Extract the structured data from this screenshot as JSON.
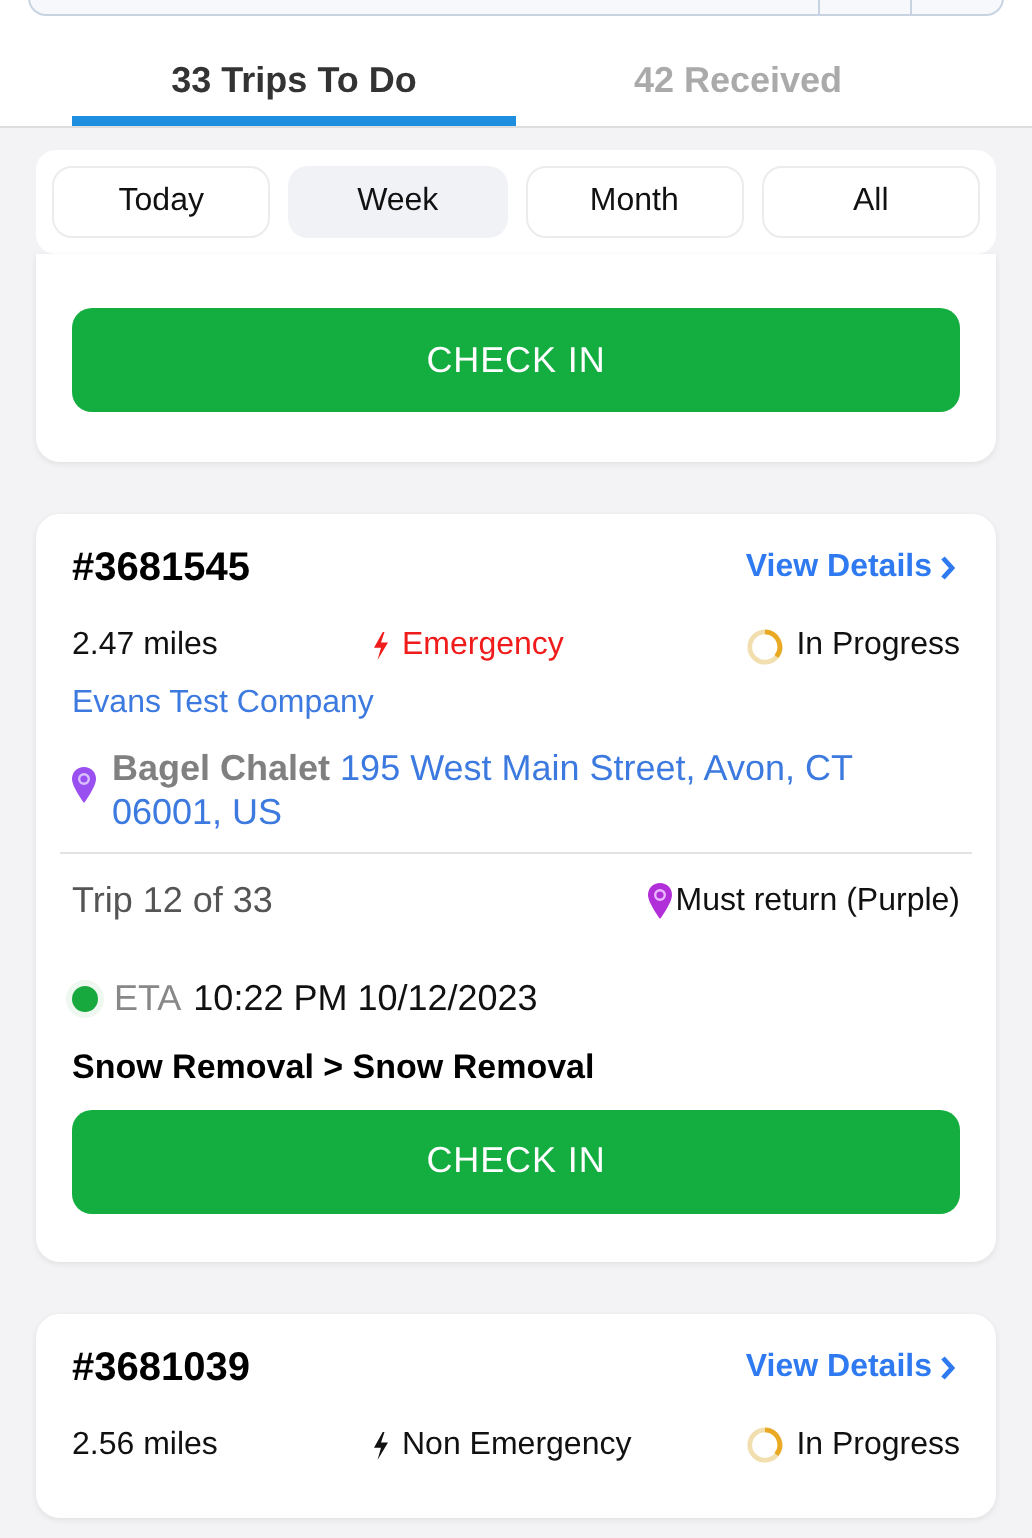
{
  "tabs": [
    {
      "label": "33 Trips To Do",
      "selected": true
    },
    {
      "label": "42 Received",
      "selected": false
    }
  ],
  "filters": [
    {
      "label": "Today",
      "selected": false
    },
    {
      "label": "Week",
      "selected": true
    },
    {
      "label": "Month",
      "selected": false
    },
    {
      "label": "All",
      "selected": false
    }
  ],
  "trips": [
    {
      "partial": true,
      "button": "CHECK IN"
    },
    {
      "number": "#3681545",
      "details_link": "View Details",
      "distance": "2.47 miles",
      "priority": {
        "kind": "emergency",
        "label": "Emergency"
      },
      "status": "In Progress",
      "company": "Evans Test Company",
      "site_name": "Bagel Chalet",
      "address": "195 West Main Street, Avon, CT 06001, US",
      "trip_count": "Trip 12 of 33",
      "return_note": "Must return (Purple)",
      "eta_label": "ETA",
      "eta": "10:22 PM 10/12/2023",
      "service": "Snow Removal > Snow Removal",
      "button": "CHECK IN"
    },
    {
      "number": "#3681039",
      "details_link": "View Details",
      "distance": "2.56 miles",
      "priority": {
        "kind": "non_emergency",
        "label": "Non Emergency"
      },
      "status": "In Progress"
    }
  ]
}
